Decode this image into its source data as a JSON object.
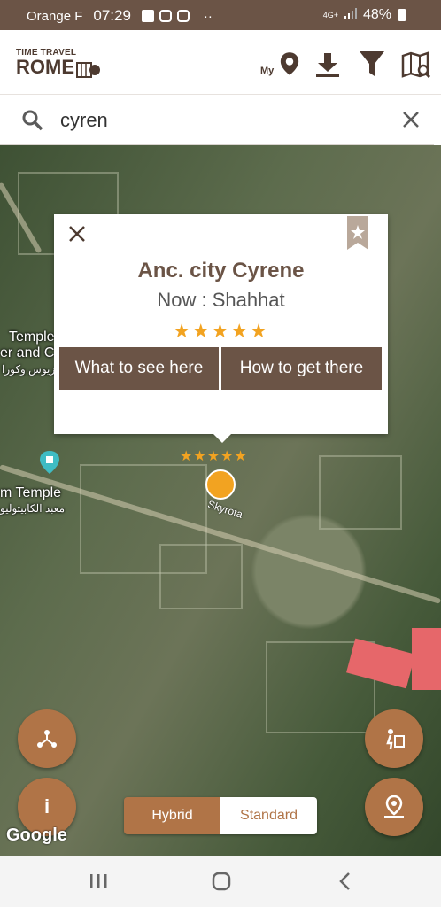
{
  "status": {
    "carrier": "Orange F",
    "time": "07:29",
    "more": "··",
    "network": "4G+",
    "battery": "48%"
  },
  "app": {
    "logo_top": "TIME TRAVEL",
    "logo_main": "ROME",
    "my_label": "My"
  },
  "search": {
    "value": "cyren"
  },
  "map": {
    "labels": {
      "temple1_a": "Temple",
      "temple1_b": "er and C",
      "temple1_ar": "زيوس وكورا",
      "temple2": "m Temple",
      "temple2_ar": "معبد الكابيتوليو",
      "site_label": "Skyrota"
    },
    "site_stars": "★★★★★",
    "attribution": "Google"
  },
  "popup": {
    "title": "Anc. city Cyrene",
    "now": "Now :  Shahhat",
    "stars": "★★★★★",
    "btn_see": "What to see here",
    "btn_get": "How to get there"
  },
  "map_type": {
    "option_hybrid": "Hybrid",
    "option_standard": "Standard",
    "selected": "Hybrid"
  },
  "fab": {
    "info_label": "i"
  },
  "colors": {
    "brand": "#6b5446",
    "accent": "#b07447",
    "star": "#f2a321"
  }
}
